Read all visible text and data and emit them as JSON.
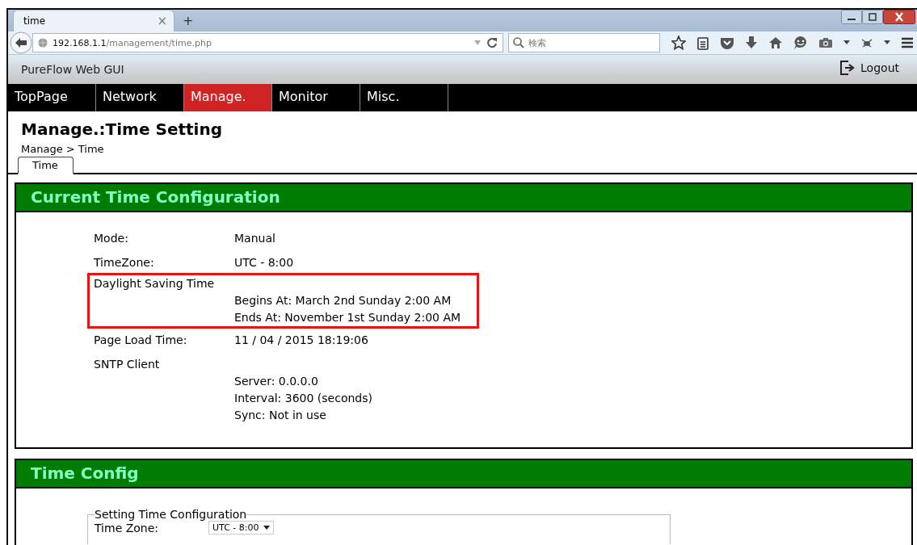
{
  "browser": {
    "tab_title": "time",
    "new_tab": "+",
    "close_tab": "×",
    "url_host": "192.168.1.1",
    "url_path": "/management/time.php",
    "search_placeholder": "検索"
  },
  "header": {
    "title": "PureFlow Web GUI",
    "logout": "Logout"
  },
  "nav": [
    {
      "label": "TopPage",
      "selected": false
    },
    {
      "label": "Network",
      "selected": false
    },
    {
      "label": "Manage.",
      "selected": true
    },
    {
      "label": "Monitor",
      "selected": false
    },
    {
      "label": "Misc.",
      "selected": false
    }
  ],
  "page_title": "Manage.:Time Setting",
  "breadcrumb": "Manage > Time",
  "subtabs": [
    {
      "label": "Time",
      "selected": true
    }
  ],
  "current": {
    "title": "Current Time Configuration",
    "rows": [
      {
        "kind": "inline",
        "label": "Mode:",
        "values": [
          "Manual"
        ],
        "highlighted": false
      },
      {
        "kind": "inline",
        "label": "TimeZone:",
        "values": [
          "UTC - 8:00"
        ],
        "highlighted": false
      },
      {
        "kind": "block",
        "label": "Daylight Saving Time",
        "values": [
          "Begins At: March 2nd Sunday 2:00 AM",
          "Ends At: November 1st Sunday 2:00 AM"
        ],
        "highlighted": true
      },
      {
        "kind": "inline",
        "label": "Page Load Time:",
        "values": [
          "11 / 04 / 2015 18:19:06"
        ],
        "highlighted": false
      },
      {
        "kind": "block",
        "label": "SNTP Client",
        "values": [
          "Server: 0.0.0.0",
          "Interval: 3600 (seconds)",
          "Sync: Not in use"
        ],
        "highlighted": false
      }
    ]
  },
  "config": {
    "title": "Time Config",
    "legend": "Setting Time Configuration",
    "fields": [
      {
        "label": "Time Zone:",
        "value": "UTC - 8:00"
      }
    ]
  }
}
